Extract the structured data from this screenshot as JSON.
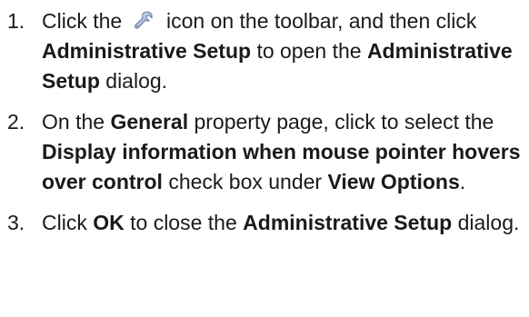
{
  "steps": [
    {
      "number": "1.",
      "parts": {
        "t1": "Click the",
        "icon": "wrench-icon",
        "t2": "icon on the toolbar, and then click",
        "b1": "Administrative Setup",
        "t3": "to open the",
        "b2": "Administrative Setup",
        "t4": "dialog."
      }
    },
    {
      "number": "2.",
      "parts": {
        "t1": "On the",
        "b1": "General",
        "t2": "property page, click to select the",
        "b2": "Display information when mouse pointer hovers over control",
        "t3": "check box under",
        "b3": "View Options",
        "t4": "."
      }
    },
    {
      "number": "3.",
      "parts": {
        "t1": "Click",
        "b1": "OK",
        "t2": "to close the",
        "b2": "Administrative Setup",
        "t3": "dialog."
      }
    }
  ],
  "colors": {
    "text": "#1a1a1a",
    "icon_light": "#c9d6ea",
    "icon_dark": "#6f86ad"
  }
}
